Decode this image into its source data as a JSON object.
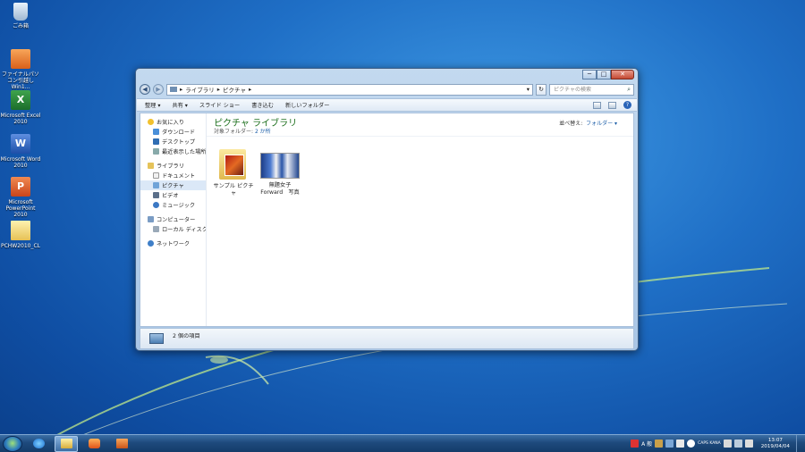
{
  "desktop": {
    "icons": [
      {
        "label": "ごみ箱",
        "icon": "recycle-bin-icon"
      },
      {
        "label": "ファイナルパソコン引越し Win1...",
        "icon": "app-icon"
      },
      {
        "label": "Microsoft Excel 2010",
        "icon": "excel-icon"
      },
      {
        "label": "Microsoft Word 2010",
        "icon": "word-icon"
      },
      {
        "label": "Microsoft PowerPoint 2010",
        "icon": "powerpoint-icon"
      },
      {
        "label": "PCHW2010_CL",
        "icon": "folder-icon"
      }
    ]
  },
  "window": {
    "controls": {
      "minimize": "─",
      "maximize": "□",
      "close": "✕"
    },
    "address": {
      "parts": [
        "ライブラリ",
        "ピクチャ"
      ],
      "separator": "▸"
    },
    "search_placeholder": "ピクチャの検索",
    "toolbar": [
      "整理 ▾",
      "共有 ▾",
      "スライド ショー",
      "書き込む",
      "新しいフォルダー"
    ],
    "nav": {
      "favorites": {
        "label": "お気に入り",
        "items": [
          "ダウンロード",
          "デスクトップ",
          "最近表示した場所"
        ]
      },
      "libraries": {
        "label": "ライブラリ",
        "items": [
          "ドキュメント",
          "ピクチャ",
          "ビデオ",
          "ミュージック"
        ],
        "selected": "ピクチャ"
      },
      "computer": {
        "label": "コンピューター",
        "items": [
          "ローカル ディスク (C:)"
        ]
      },
      "network": {
        "label": "ネットワーク"
      }
    },
    "library": {
      "title": "ピクチャ ライブラリ",
      "subtitle_prefix": "対象フォルダー:",
      "subtitle_link": "2 か所",
      "arrange_label": "並べ替え:",
      "arrange_value": "フォルダー ▾"
    },
    "items": [
      {
        "line1": "サンプル ピクチ",
        "line2": "ャ",
        "type": "folder"
      },
      {
        "line1": "無題女子",
        "line2": "Forward　写真",
        "type": "image"
      }
    ],
    "status_text": "2 個の項目"
  },
  "taskbar": {
    "pinned": [
      "internet-explorer-icon",
      "explorer-icon",
      "media-player-icon",
      "app-icon"
    ],
    "tray_text": "A 般",
    "ime": "CAPS KANA",
    "clock_time": "13:07",
    "clock_date": "2019/04/04"
  },
  "colors": {
    "accent": "#1f6fc6",
    "library_title": "#1b6e1b",
    "link": "#1c5ea8"
  }
}
